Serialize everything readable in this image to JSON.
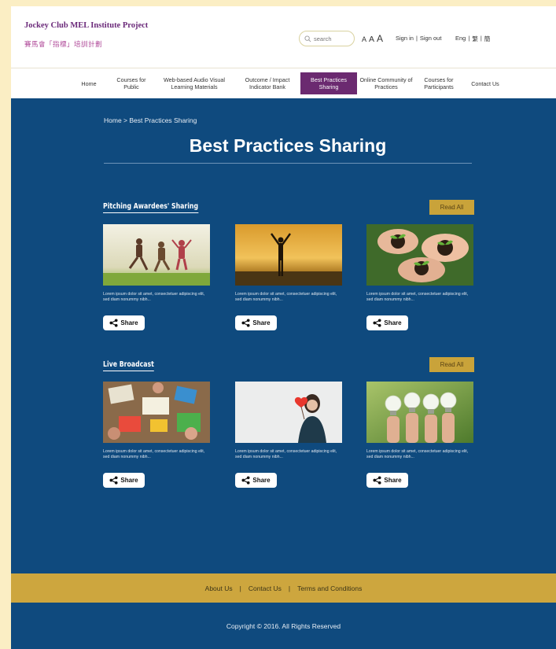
{
  "header": {
    "brand_en": "Jockey Club MEL Institute Project",
    "brand_zh": "賽馬會「指標」培訓計劃",
    "search_placeholder": "search",
    "font_sizes": [
      "A",
      "A",
      "A"
    ],
    "sign_in": "Sign in",
    "sign_out": "Sign out",
    "separator": "|",
    "lang": [
      "Eng",
      "繁",
      "簡"
    ]
  },
  "nav": {
    "items": [
      {
        "label": "Home"
      },
      {
        "label": "Courses for Public"
      },
      {
        "label": "Web-based Audio Visual Learning Materials"
      },
      {
        "label": "Outcome / Impact Indicator Bank"
      },
      {
        "label": "Best Practices Sharing",
        "active": true
      },
      {
        "label": "Online Community of Practices"
      },
      {
        "label": "Courses for Participants"
      },
      {
        "label": "Contact Us"
      }
    ]
  },
  "main": {
    "breadcrumb": "Home > Best Practices Sharing",
    "title": "Best Practices Sharing",
    "sections": [
      {
        "title": "Pitching Awardees' Sharing",
        "read_all": "Read All",
        "cards": [
          {
            "text": "Lorem ipsum dolor sit amet, consectetuer adipiscing elit, sed diam nonummy nibh...",
            "share": "Share",
            "image": "people-jumping-photo"
          },
          {
            "text": "Lorem ipsum dolor sit amet, consectetuer adipiscing elit, sed diam nonummy nibh...",
            "share": "Share",
            "image": "sunset-silhouette-photo"
          },
          {
            "text": "Lorem ipsum dolor sit amet, consectetuer adipiscing elit, sed diam nonummy nibh...",
            "share": "Share",
            "image": "hands-seedlings-photo"
          }
        ]
      },
      {
        "title": "Live Broadcast",
        "read_all": "Read All",
        "cards": [
          {
            "text": "Lorem ipsum dolor sit amet, consectetuer adipiscing elit, sed diam nonummy nibh...",
            "share": "Share",
            "image": "workshop-table-photo"
          },
          {
            "text": "Lorem ipsum dolor sit amet, consectetuer adipiscing elit, sed diam nonummy nibh...",
            "share": "Share",
            "image": "woman-heart-photo"
          },
          {
            "text": "Lorem ipsum dolor sit amet, consectetuer adipiscing elit, sed diam nonummy nibh...",
            "share": "Share",
            "image": "hands-lightbulbs-photo"
          }
        ]
      }
    ]
  },
  "footer": {
    "links": [
      "About Us",
      "Contact Us",
      "Terms and Conditions"
    ],
    "separator": "|",
    "copyright": "Copyright © 2016. All Rights Reserved"
  },
  "colors": {
    "main_bg": "#0f4a7e",
    "accent_gold": "#cda63e",
    "nav_active": "#6b2a70",
    "brand_purple": "#6b2a7a",
    "page_bg": "#fbeec4"
  }
}
